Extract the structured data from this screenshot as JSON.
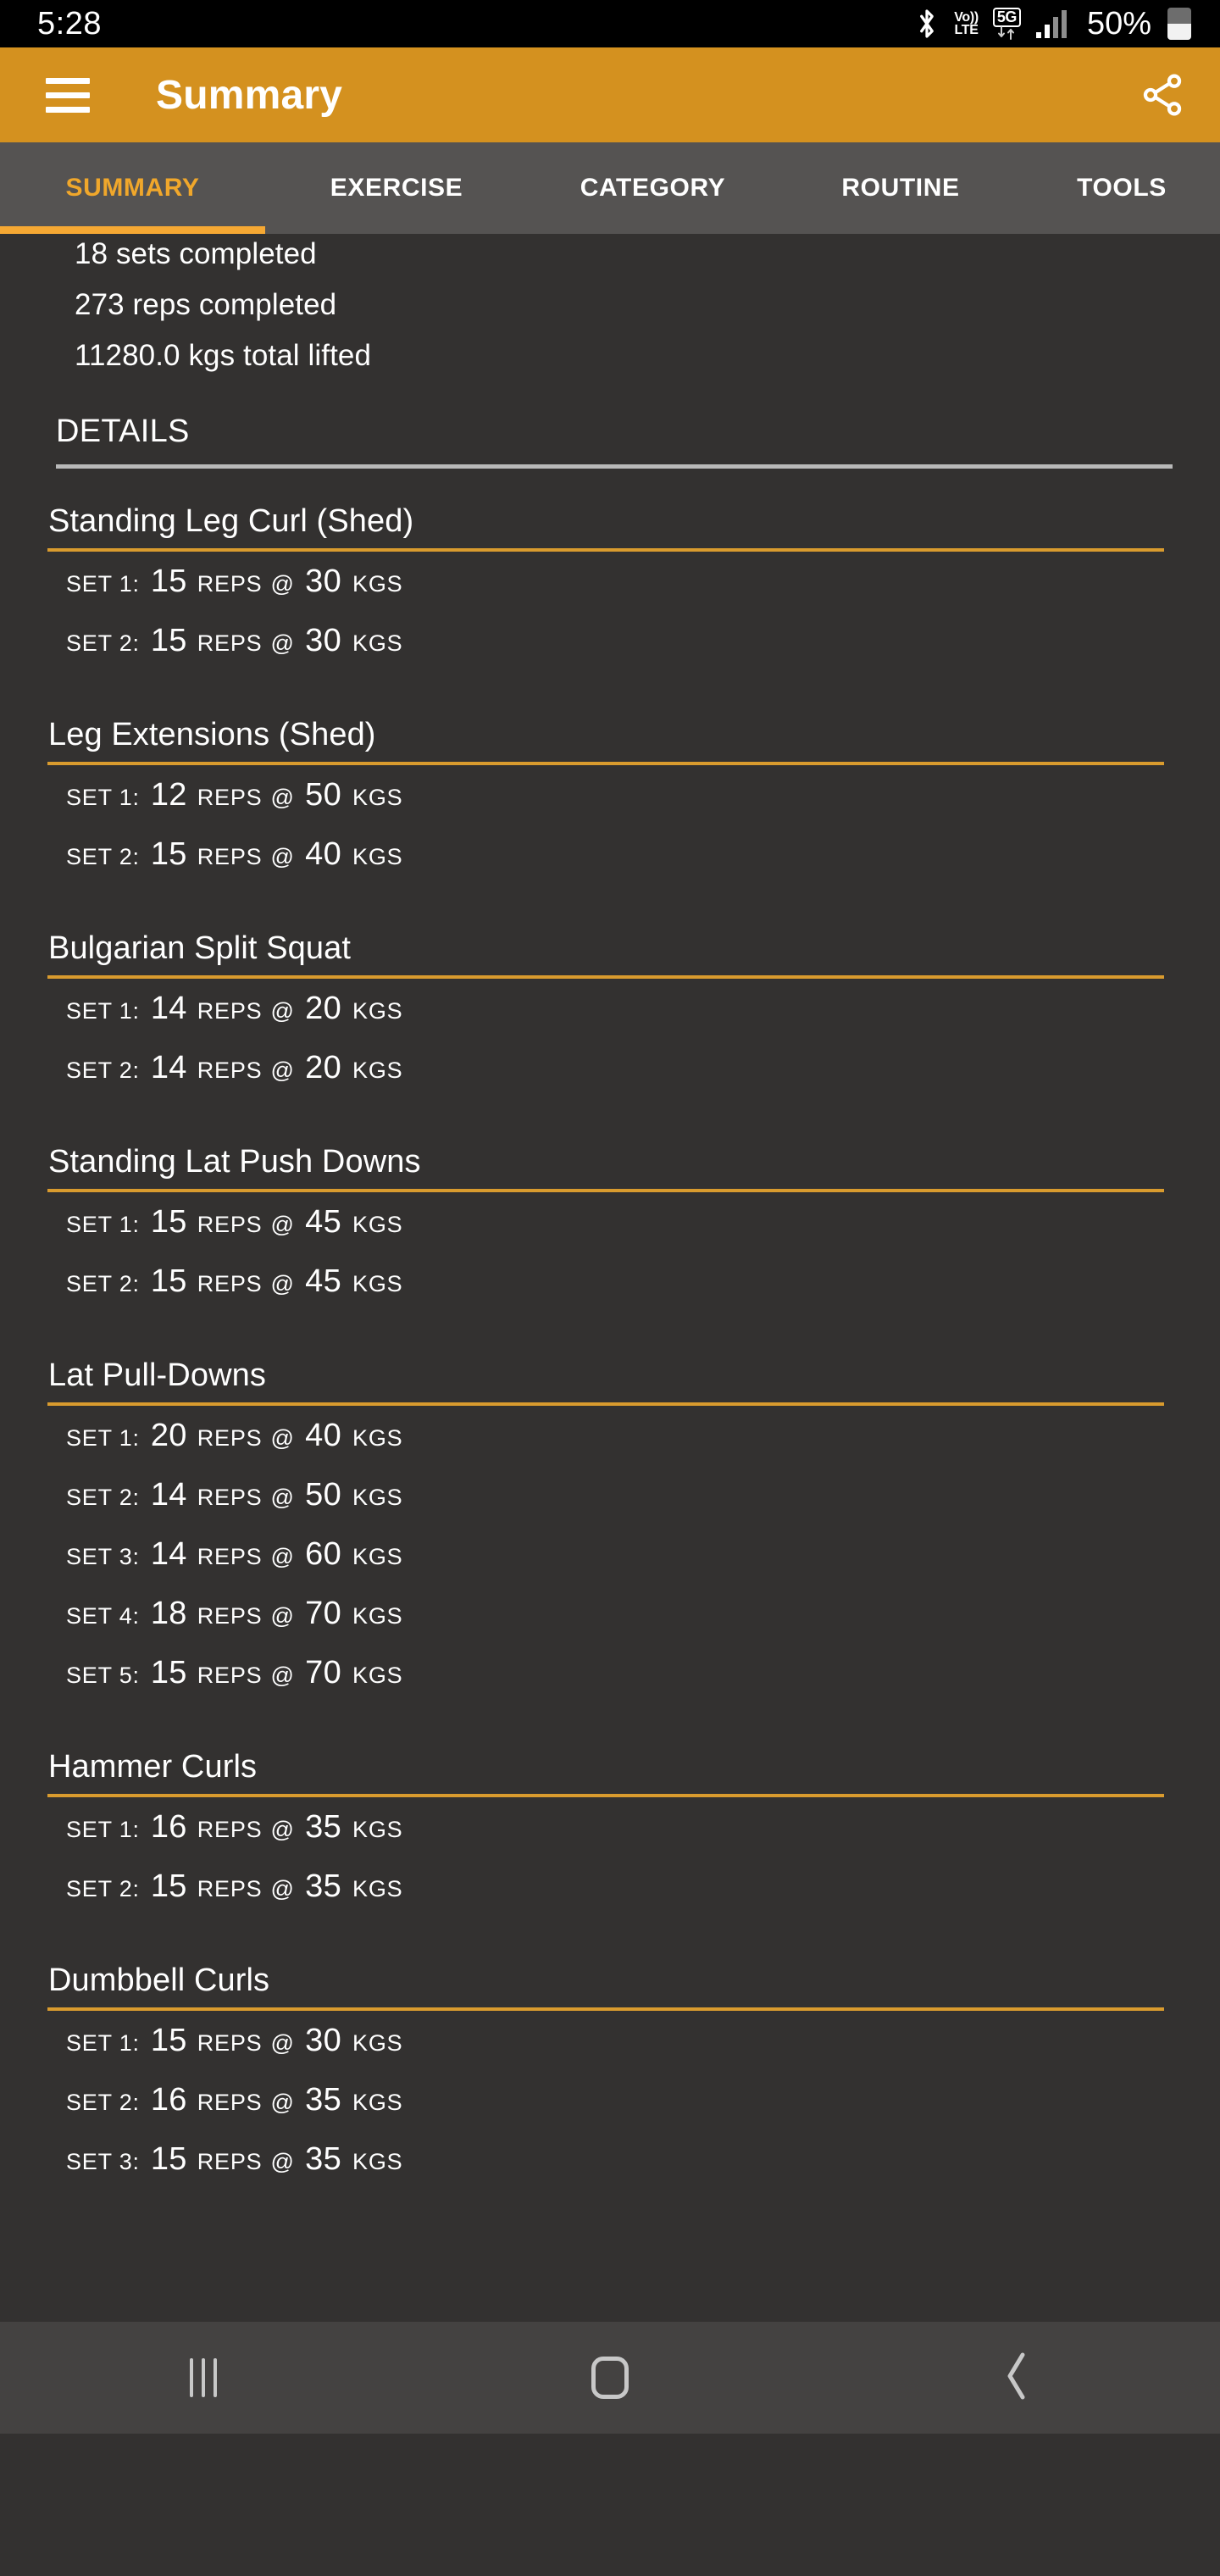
{
  "status_bar": {
    "time": "5:28",
    "battery_percent": "50%",
    "icons": [
      "bluetooth-icon",
      "volte-icon",
      "5g-icon",
      "signal-icon",
      "battery-icon"
    ],
    "volte_top": "Vo))",
    "volte_bottom": "LTE",
    "network_label": "5G"
  },
  "app_bar": {
    "title": "Summary",
    "menu_icon": "hamburger-menu-icon",
    "share_icon": "share-icon",
    "background_color": "#d4911f"
  },
  "tabs": {
    "active_index": 0,
    "accent_color": "#f0a72b",
    "items": [
      {
        "label": "SUMMARY"
      },
      {
        "label": "EXERCISE"
      },
      {
        "label": "CATEGORY"
      },
      {
        "label": "ROUTINE"
      },
      {
        "label": "TOOLS"
      }
    ]
  },
  "summary_stats": [
    "18 sets completed",
    "273 reps completed",
    "11280.0 kgs total lifted"
  ],
  "details": {
    "heading": "DETAILS",
    "exercises": [
      {
        "name": "Standing Leg Curl (Shed)",
        "sets": [
          {
            "label": "SET 1:",
            "reps": "15",
            "reps_word": "REPS",
            "at": "@",
            "weight": "30",
            "unit": "KGS"
          },
          {
            "label": "SET 2:",
            "reps": "15",
            "reps_word": "REPS",
            "at": "@",
            "weight": "30",
            "unit": "KGS"
          }
        ]
      },
      {
        "name": "Leg Extensions (Shed)",
        "sets": [
          {
            "label": "SET 1:",
            "reps": "12",
            "reps_word": "REPS",
            "at": "@",
            "weight": "50",
            "unit": "KGS"
          },
          {
            "label": "SET 2:",
            "reps": "15",
            "reps_word": "REPS",
            "at": "@",
            "weight": "40",
            "unit": "KGS"
          }
        ]
      },
      {
        "name": "Bulgarian Split Squat",
        "sets": [
          {
            "label": "SET 1:",
            "reps": "14",
            "reps_word": "REPS",
            "at": "@",
            "weight": "20",
            "unit": "KGS"
          },
          {
            "label": "SET 2:",
            "reps": "14",
            "reps_word": "REPS",
            "at": "@",
            "weight": "20",
            "unit": "KGS"
          }
        ]
      },
      {
        "name": "Standing Lat Push Downs",
        "sets": [
          {
            "label": "SET 1:",
            "reps": "15",
            "reps_word": "REPS",
            "at": "@",
            "weight": "45",
            "unit": "KGS"
          },
          {
            "label": "SET 2:",
            "reps": "15",
            "reps_word": "REPS",
            "at": "@",
            "weight": "45",
            "unit": "KGS"
          }
        ]
      },
      {
        "name": "Lat Pull-Downs",
        "sets": [
          {
            "label": "SET 1:",
            "reps": "20",
            "reps_word": "REPS",
            "at": "@",
            "weight": "40",
            "unit": "KGS"
          },
          {
            "label": "SET 2:",
            "reps": "14",
            "reps_word": "REPS",
            "at": "@",
            "weight": "50",
            "unit": "KGS"
          },
          {
            "label": "SET 3:",
            "reps": "14",
            "reps_word": "REPS",
            "at": "@",
            "weight": "60",
            "unit": "KGS"
          },
          {
            "label": "SET 4:",
            "reps": "18",
            "reps_word": "REPS",
            "at": "@",
            "weight": "70",
            "unit": "KGS"
          },
          {
            "label": "SET 5:",
            "reps": "15",
            "reps_word": "REPS",
            "at": "@",
            "weight": "70",
            "unit": "KGS"
          }
        ]
      },
      {
        "name": "Hammer Curls",
        "sets": [
          {
            "label": "SET 1:",
            "reps": "16",
            "reps_word": "REPS",
            "at": "@",
            "weight": "35",
            "unit": "KGS"
          },
          {
            "label": "SET 2:",
            "reps": "15",
            "reps_word": "REPS",
            "at": "@",
            "weight": "35",
            "unit": "KGS"
          }
        ]
      },
      {
        "name": "Dumbbell Curls",
        "sets": [
          {
            "label": "SET 1:",
            "reps": "15",
            "reps_word": "REPS",
            "at": "@",
            "weight": "30",
            "unit": "KGS"
          },
          {
            "label": "SET 2:",
            "reps": "16",
            "reps_word": "REPS",
            "at": "@",
            "weight": "35",
            "unit": "KGS"
          },
          {
            "label": "SET 3:",
            "reps": "15",
            "reps_word": "REPS",
            "at": "@",
            "weight": "35",
            "unit": "KGS"
          }
        ]
      }
    ]
  },
  "nav_bar": {
    "recents_icon": "recents-icon",
    "home_icon": "home-icon",
    "back_icon": "back-icon"
  }
}
